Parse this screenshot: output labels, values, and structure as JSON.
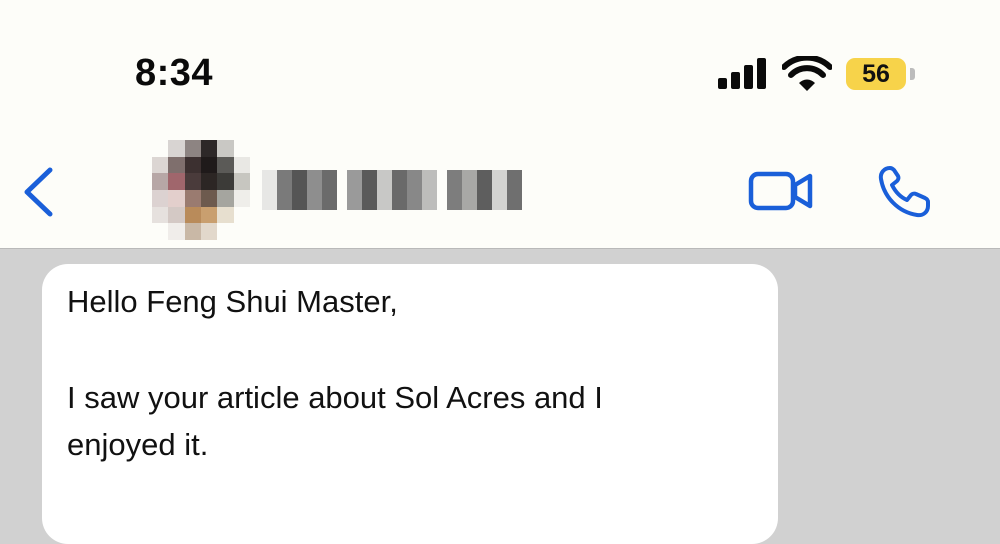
{
  "status_bar": {
    "time": "8:34",
    "battery_level": "56",
    "battery_color": "#f7d34a",
    "signal_icon": "cellular-signal-icon",
    "wifi_icon": "wifi-icon"
  },
  "header": {
    "back_icon": "chevron-left-icon",
    "avatar": "blurred-contact-avatar",
    "contact_name_state": "pixelated",
    "video_call_icon": "video-camera-icon",
    "voice_call_icon": "phone-icon",
    "accent_color": "#1a5fd9"
  },
  "message": {
    "line1": "Hello Feng Shui Master,",
    "line2": "I saw your article about Sol Acres and I",
    "line3": "enjoyed it."
  }
}
